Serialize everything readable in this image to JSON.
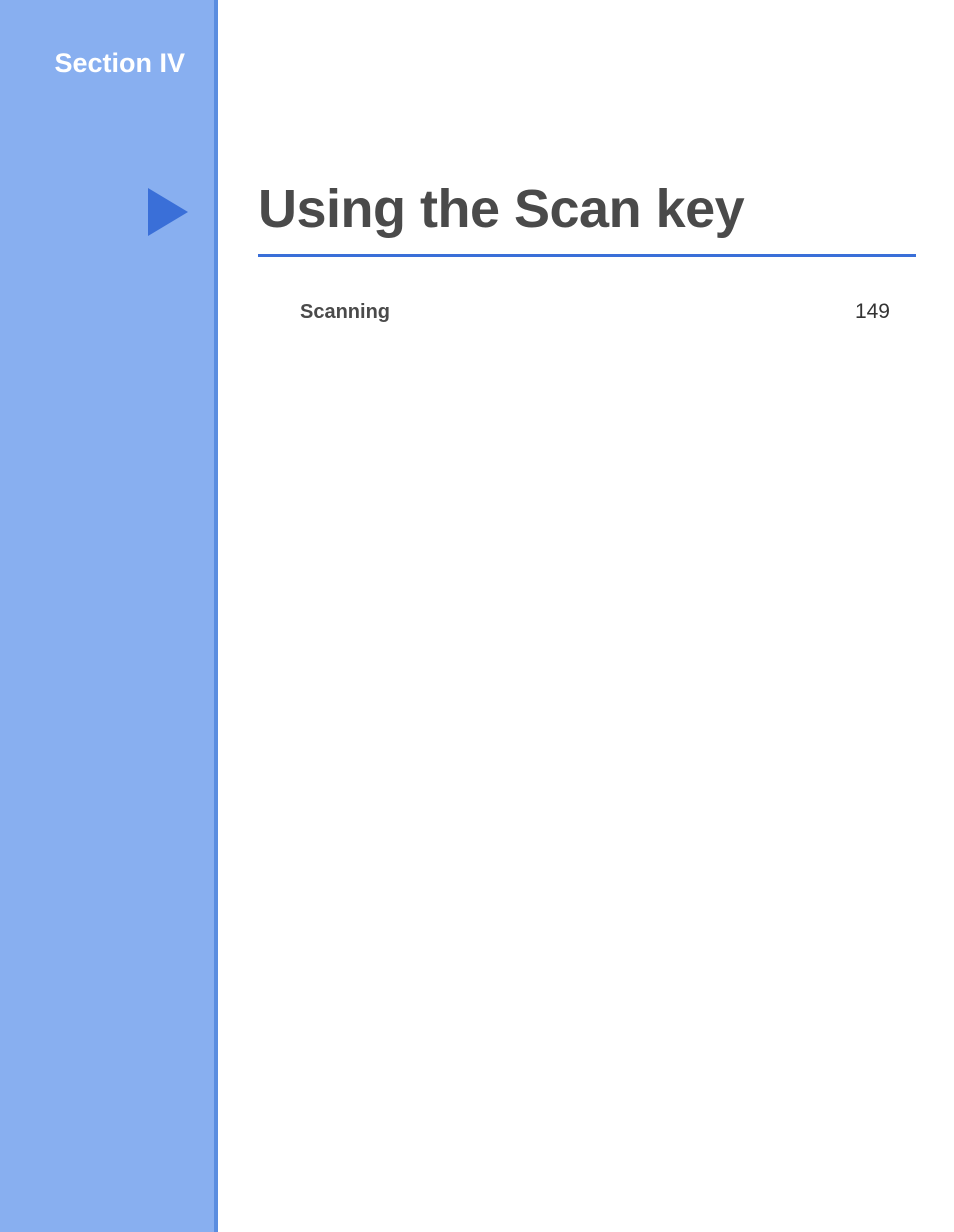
{
  "sidebar": {
    "section_label": "Section IV"
  },
  "main": {
    "title": "Using the Scan key"
  },
  "toc": {
    "entries": [
      {
        "label": "Scanning",
        "page": "149"
      }
    ]
  }
}
